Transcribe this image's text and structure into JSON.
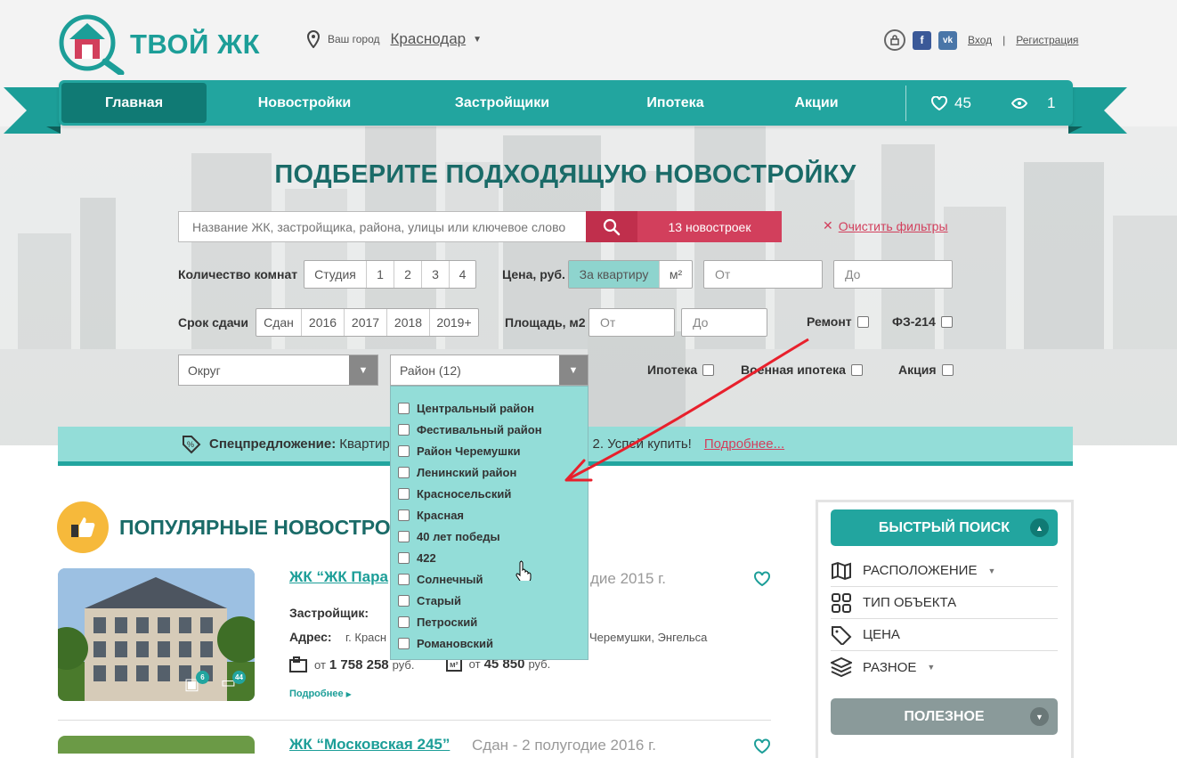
{
  "brand": {
    "name": "ТВОЙ ЖК"
  },
  "city": {
    "label": "Ваш город",
    "value": "Краснодар"
  },
  "auth": {
    "login": "Вход",
    "register": "Регистрация",
    "separator": "|"
  },
  "nav": {
    "items": [
      "Главная",
      "Новостройки",
      "Застройщики",
      "Ипотека",
      "Акции"
    ],
    "favorites_count": "45",
    "views_count": "1"
  },
  "hero": {
    "title": "ПОДБЕРИТЕ ПОДХОДЯЩУЮ НОВОСТРОЙКУ"
  },
  "search": {
    "placeholder": "Название ЖК, застройщика, района, улицы или ключевое слово",
    "button_label": "13 новостроек",
    "clear_label": "Очистить фильтры"
  },
  "filters": {
    "rooms_label": "Количество комнат",
    "rooms": [
      "Студия",
      "1",
      "2",
      "3",
      "4"
    ],
    "price_label": "Цена, руб.",
    "price_modes": [
      "За квартиру",
      "м²"
    ],
    "from_placeholder": "От",
    "to_placeholder": "До",
    "deadline_label": "Срок сдачи",
    "deadlines": [
      "Сдан",
      "2016",
      "2017",
      "2018",
      "2019+"
    ],
    "area_label": "Площадь, м2",
    "remont_label": "Ремонт",
    "fz_label": "ФЗ-214",
    "okrug_label": "Округ",
    "rayon_label": "Район (12)",
    "ipoteka_label": "Ипотека",
    "voen_label": "Военная ипотека",
    "akcia_label": "Акция"
  },
  "district_dropdown": [
    "Центральный район",
    "Фестивальный район",
    "Район Черемушки",
    "Ленинский район",
    "Красносельский",
    "Красная",
    "40 лет победы",
    "422",
    "Солнечный",
    "Старый",
    "Петроский",
    "Романовский"
  ],
  "promo": {
    "label": "Спецпредложение:",
    "text_left": "Квартиры",
    "text_right": "2. Успей купить!",
    "link": "Подробнее..."
  },
  "popular": {
    "title": "ПОПУЛЯРНЫЕ НОВОСТРОЙ"
  },
  "listing1": {
    "title": "ЖК “ЖК Пара",
    "status": "дие 2015 г.",
    "developer_key": "Застройщик:",
    "address_key": "Адрес:",
    "address_left": "г. Красн",
    "address_right": "Черемушки, Энгельса",
    "price_from": "от",
    "price": "1 758 258",
    "price_unit": "руб.",
    "per_m2_from": "от",
    "per_m2": "45 850",
    "per_m2_unit": "руб.",
    "photos": "6",
    "comments": "44",
    "more": "Подробнее"
  },
  "listing2": {
    "title": "ЖК “Московская 245”",
    "status": "Сдан - 2 полугодие 2016 г."
  },
  "sidebar": {
    "quick_search": "БЫСТРЫЙ ПОИСК",
    "items": [
      "РАСПОЛОЖЕНИЕ",
      "ТИП ОБЪЕКТА",
      "ЦЕНА",
      "РАЗНОЕ"
    ],
    "useful": "ПОЛЕЗНОЕ"
  },
  "colors": {
    "teal": "#22a59f",
    "dark_teal": "#107a74",
    "light_teal": "#93ddd8",
    "red": "#d23f5c",
    "orange": "#f6b93b"
  }
}
